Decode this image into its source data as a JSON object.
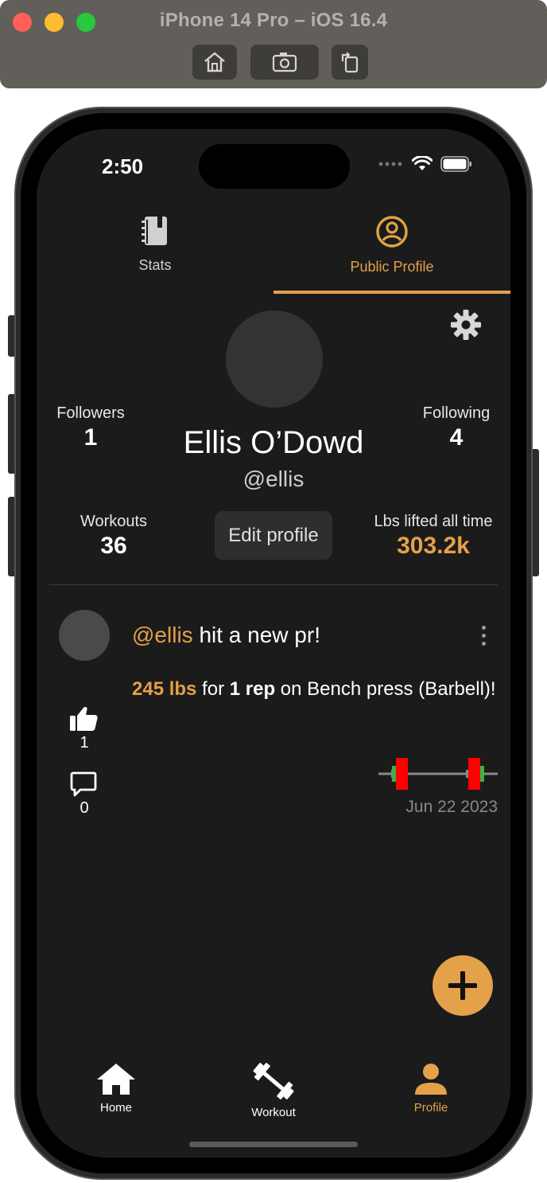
{
  "simulator": {
    "title": "iPhone 14 Pro – iOS 16.4",
    "buttons": [
      "home-icon",
      "screenshot-icon",
      "rotate-icon"
    ]
  },
  "status_bar": {
    "time": "2:50"
  },
  "tabs": [
    {
      "label": "Stats",
      "icon": "notebook-icon",
      "active": false
    },
    {
      "label": "Public Profile",
      "icon": "account-circle-icon",
      "active": true
    }
  ],
  "profile": {
    "name": "Ellis O’Dowd",
    "handle": "@ellis",
    "followers_label": "Followers",
    "followers": "1",
    "following_label": "Following",
    "following": "4",
    "workouts_label": "Workouts",
    "workouts": "36",
    "lbs_label": "Lbs lifted all time",
    "lbs": "303.2k",
    "edit_button": "Edit profile"
  },
  "post": {
    "user": "@ellis",
    "headline": " hit a new pr!",
    "weight": "245 lbs",
    "for_text": " for ",
    "reps": "1 rep",
    "exercise": " on Bench press (Barbell)!",
    "likes": "1",
    "comments": "0",
    "date": "Jun 22 2023"
  },
  "nav": [
    {
      "label": "Home",
      "icon": "home-icon",
      "active": false
    },
    {
      "label": "Workout",
      "icon": "dumbbell-icon",
      "active": false
    },
    {
      "label": "Profile",
      "icon": "person-icon",
      "active": true
    }
  ],
  "colors": {
    "accent": "#e3a149",
    "background": "#1b1b1b",
    "plate_red": "#ff0000",
    "plate_green": "#3cb043"
  }
}
